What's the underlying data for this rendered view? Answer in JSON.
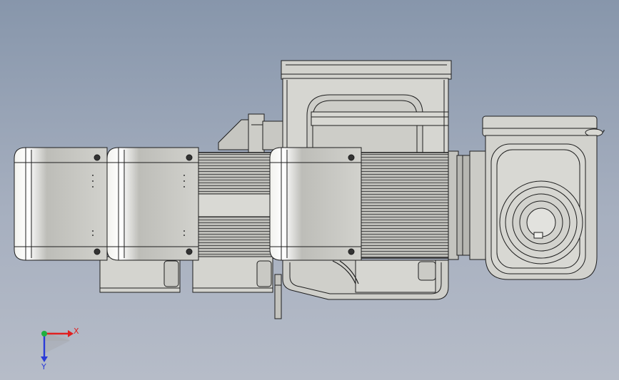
{
  "view": {
    "background_top": "#8796ab",
    "background_bottom": "#b6bcc8",
    "model_color": "#d3d3cf",
    "edge_color": "#1e1e1e"
  },
  "triad": {
    "x_label": "X",
    "y_label": "Y",
    "x_color": "#e02020",
    "y_color": "#2a3ad8",
    "z_color": "#20b040",
    "x_icon": "arrow-right-icon",
    "y_icon": "arrow-down-icon"
  }
}
